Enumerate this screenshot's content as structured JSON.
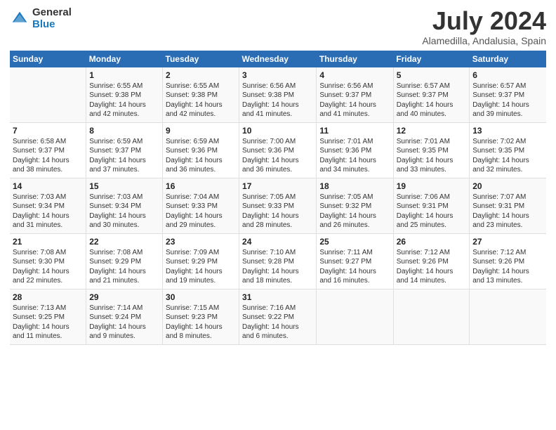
{
  "header": {
    "logo_general": "General",
    "logo_blue": "Blue",
    "month_year": "July 2024",
    "location": "Alamedilla, Andalusia, Spain"
  },
  "weekdays": [
    "Sunday",
    "Monday",
    "Tuesday",
    "Wednesday",
    "Thursday",
    "Friday",
    "Saturday"
  ],
  "weeks": [
    [
      {
        "day": "",
        "sunrise": "",
        "sunset": "",
        "daylight": ""
      },
      {
        "day": "1",
        "sunrise": "Sunrise: 6:55 AM",
        "sunset": "Sunset: 9:38 PM",
        "daylight": "Daylight: 14 hours and 42 minutes."
      },
      {
        "day": "2",
        "sunrise": "Sunrise: 6:55 AM",
        "sunset": "Sunset: 9:38 PM",
        "daylight": "Daylight: 14 hours and 42 minutes."
      },
      {
        "day": "3",
        "sunrise": "Sunrise: 6:56 AM",
        "sunset": "Sunset: 9:38 PM",
        "daylight": "Daylight: 14 hours and 41 minutes."
      },
      {
        "day": "4",
        "sunrise": "Sunrise: 6:56 AM",
        "sunset": "Sunset: 9:37 PM",
        "daylight": "Daylight: 14 hours and 41 minutes."
      },
      {
        "day": "5",
        "sunrise": "Sunrise: 6:57 AM",
        "sunset": "Sunset: 9:37 PM",
        "daylight": "Daylight: 14 hours and 40 minutes."
      },
      {
        "day": "6",
        "sunrise": "Sunrise: 6:57 AM",
        "sunset": "Sunset: 9:37 PM",
        "daylight": "Daylight: 14 hours and 39 minutes."
      }
    ],
    [
      {
        "day": "7",
        "sunrise": "Sunrise: 6:58 AM",
        "sunset": "Sunset: 9:37 PM",
        "daylight": "Daylight: 14 hours and 38 minutes."
      },
      {
        "day": "8",
        "sunrise": "Sunrise: 6:59 AM",
        "sunset": "Sunset: 9:37 PM",
        "daylight": "Daylight: 14 hours and 37 minutes."
      },
      {
        "day": "9",
        "sunrise": "Sunrise: 6:59 AM",
        "sunset": "Sunset: 9:36 PM",
        "daylight": "Daylight: 14 hours and 36 minutes."
      },
      {
        "day": "10",
        "sunrise": "Sunrise: 7:00 AM",
        "sunset": "Sunset: 9:36 PM",
        "daylight": "Daylight: 14 hours and 36 minutes."
      },
      {
        "day": "11",
        "sunrise": "Sunrise: 7:01 AM",
        "sunset": "Sunset: 9:36 PM",
        "daylight": "Daylight: 14 hours and 34 minutes."
      },
      {
        "day": "12",
        "sunrise": "Sunrise: 7:01 AM",
        "sunset": "Sunset: 9:35 PM",
        "daylight": "Daylight: 14 hours and 33 minutes."
      },
      {
        "day": "13",
        "sunrise": "Sunrise: 7:02 AM",
        "sunset": "Sunset: 9:35 PM",
        "daylight": "Daylight: 14 hours and 32 minutes."
      }
    ],
    [
      {
        "day": "14",
        "sunrise": "Sunrise: 7:03 AM",
        "sunset": "Sunset: 9:34 PM",
        "daylight": "Daylight: 14 hours and 31 minutes."
      },
      {
        "day": "15",
        "sunrise": "Sunrise: 7:03 AM",
        "sunset": "Sunset: 9:34 PM",
        "daylight": "Daylight: 14 hours and 30 minutes."
      },
      {
        "day": "16",
        "sunrise": "Sunrise: 7:04 AM",
        "sunset": "Sunset: 9:33 PM",
        "daylight": "Daylight: 14 hours and 29 minutes."
      },
      {
        "day": "17",
        "sunrise": "Sunrise: 7:05 AM",
        "sunset": "Sunset: 9:33 PM",
        "daylight": "Daylight: 14 hours and 28 minutes."
      },
      {
        "day": "18",
        "sunrise": "Sunrise: 7:05 AM",
        "sunset": "Sunset: 9:32 PM",
        "daylight": "Daylight: 14 hours and 26 minutes."
      },
      {
        "day": "19",
        "sunrise": "Sunrise: 7:06 AM",
        "sunset": "Sunset: 9:31 PM",
        "daylight": "Daylight: 14 hours and 25 minutes."
      },
      {
        "day": "20",
        "sunrise": "Sunrise: 7:07 AM",
        "sunset": "Sunset: 9:31 PM",
        "daylight": "Daylight: 14 hours and 23 minutes."
      }
    ],
    [
      {
        "day": "21",
        "sunrise": "Sunrise: 7:08 AM",
        "sunset": "Sunset: 9:30 PM",
        "daylight": "Daylight: 14 hours and 22 minutes."
      },
      {
        "day": "22",
        "sunrise": "Sunrise: 7:08 AM",
        "sunset": "Sunset: 9:29 PM",
        "daylight": "Daylight: 14 hours and 21 minutes."
      },
      {
        "day": "23",
        "sunrise": "Sunrise: 7:09 AM",
        "sunset": "Sunset: 9:29 PM",
        "daylight": "Daylight: 14 hours and 19 minutes."
      },
      {
        "day": "24",
        "sunrise": "Sunrise: 7:10 AM",
        "sunset": "Sunset: 9:28 PM",
        "daylight": "Daylight: 14 hours and 18 minutes."
      },
      {
        "day": "25",
        "sunrise": "Sunrise: 7:11 AM",
        "sunset": "Sunset: 9:27 PM",
        "daylight": "Daylight: 14 hours and 16 minutes."
      },
      {
        "day": "26",
        "sunrise": "Sunrise: 7:12 AM",
        "sunset": "Sunset: 9:26 PM",
        "daylight": "Daylight: 14 hours and 14 minutes."
      },
      {
        "day": "27",
        "sunrise": "Sunrise: 7:12 AM",
        "sunset": "Sunset: 9:26 PM",
        "daylight": "Daylight: 14 hours and 13 minutes."
      }
    ],
    [
      {
        "day": "28",
        "sunrise": "Sunrise: 7:13 AM",
        "sunset": "Sunset: 9:25 PM",
        "daylight": "Daylight: 14 hours and 11 minutes."
      },
      {
        "day": "29",
        "sunrise": "Sunrise: 7:14 AM",
        "sunset": "Sunset: 9:24 PM",
        "daylight": "Daylight: 14 hours and 9 minutes."
      },
      {
        "day": "30",
        "sunrise": "Sunrise: 7:15 AM",
        "sunset": "Sunset: 9:23 PM",
        "daylight": "Daylight: 14 hours and 8 minutes."
      },
      {
        "day": "31",
        "sunrise": "Sunrise: 7:16 AM",
        "sunset": "Sunset: 9:22 PM",
        "daylight": "Daylight: 14 hours and 6 minutes."
      },
      {
        "day": "",
        "sunrise": "",
        "sunset": "",
        "daylight": ""
      },
      {
        "day": "",
        "sunrise": "",
        "sunset": "",
        "daylight": ""
      },
      {
        "day": "",
        "sunrise": "",
        "sunset": "",
        "daylight": ""
      }
    ]
  ]
}
